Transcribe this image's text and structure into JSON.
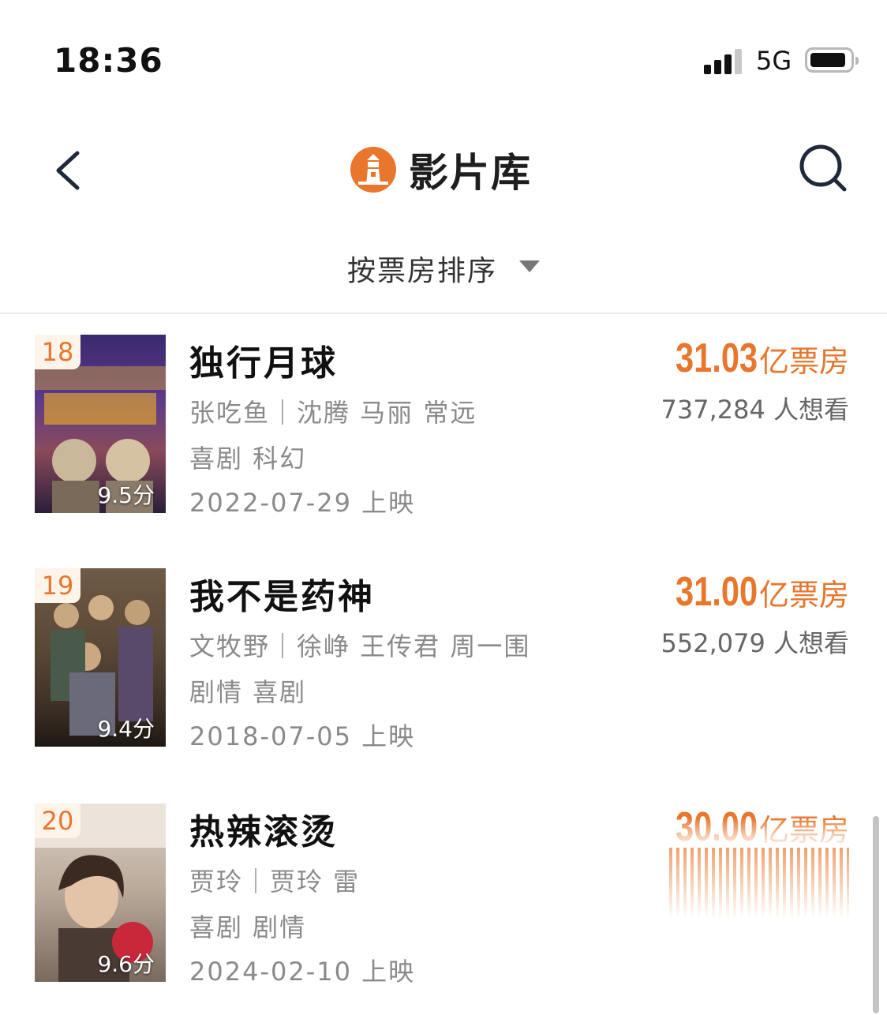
{
  "status": {
    "time": "18:36",
    "network": "5G"
  },
  "nav": {
    "title": "影片库"
  },
  "sort": {
    "label": "按票房排序"
  },
  "colors": {
    "accent": "#e8762c",
    "text": "#111111",
    "secondary": "#8a8a8a"
  },
  "movies": [
    {
      "rank": "18",
      "title": "独行月球",
      "credits": "张吃鱼｜沈腾 马丽 常远",
      "genres": "喜剧 科幻",
      "release": "2022-07-29 上映",
      "score": "9.5分",
      "box_office": "31.03",
      "box_unit": "亿票房",
      "want": "737,284 人想看"
    },
    {
      "rank": "19",
      "title": "我不是药神",
      "credits": "文牧野｜徐峥 王传君 周一围",
      "genres": "剧情 喜剧",
      "release": "2018-07-05 上映",
      "score": "9.4分",
      "box_office": "31.00",
      "box_unit": "亿票房",
      "want": "552,079 人想看"
    },
    {
      "rank": "20",
      "title": "热辣滚烫",
      "credits": "贾玲｜贾玲 雷",
      "genres": "喜剧 剧情",
      "release": "2024-02-10 上映",
      "score": "9.6分",
      "box_office": "30.00",
      "box_unit": "亿票房"
    }
  ]
}
